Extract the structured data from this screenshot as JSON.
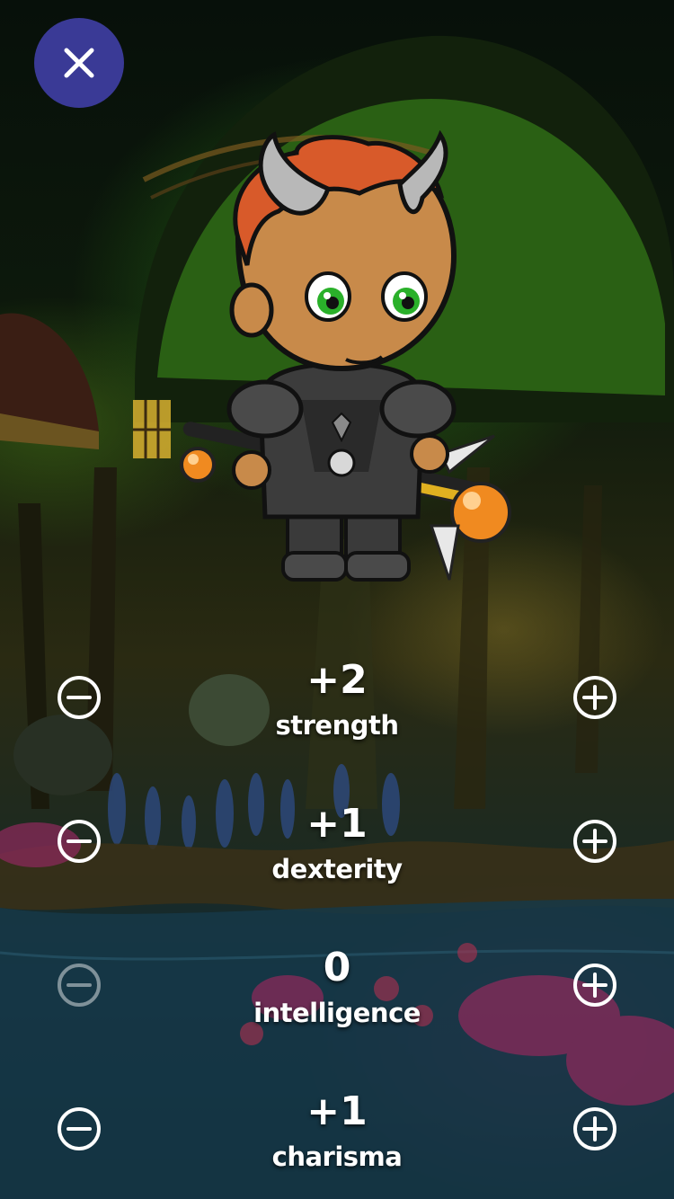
{
  "close_button": {
    "icon": "close-icon",
    "color": "#3a3a96"
  },
  "character": {
    "name_icon": "horned-warrior-avatar"
  },
  "stats": [
    {
      "value": "+2",
      "label": "strength",
      "minus_enabled": true,
      "plus_enabled": true
    },
    {
      "value": "+1",
      "label": "dexterity",
      "minus_enabled": true,
      "plus_enabled": true
    },
    {
      "value": "0",
      "label": "intelligence",
      "minus_enabled": false,
      "plus_enabled": true
    },
    {
      "value": "+1",
      "label": "charisma",
      "minus_enabled": true,
      "plus_enabled": true
    }
  ],
  "icons": {
    "decrease": "minus-circle-icon",
    "increase": "plus-circle-icon"
  }
}
